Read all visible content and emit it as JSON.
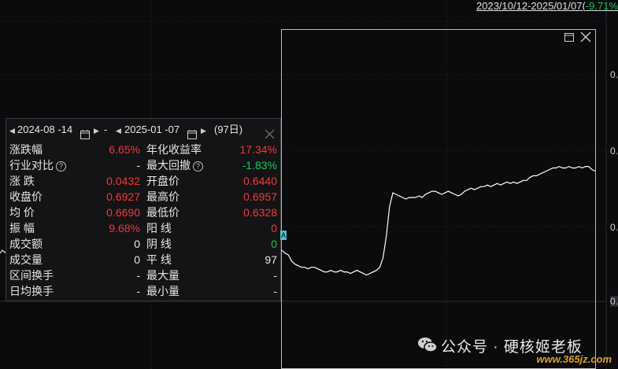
{
  "header": {
    "range_text": "2023/10/12-2025/01/07(",
    "range_change": "-9.71%"
  },
  "y_axis": {
    "tick_prefix": [
      "0.",
      "0.",
      "0.",
      "0."
    ]
  },
  "chart_data": {
    "type": "line",
    "series": [
      {
        "values": [
          0.647,
          0.645,
          0.644,
          0.64,
          0.638,
          0.637,
          0.636,
          0.636,
          0.635,
          0.636,
          0.636,
          0.635,
          0.634,
          0.633,
          0.633,
          0.634,
          0.633,
          0.633,
          0.634,
          0.633,
          0.633,
          0.632,
          0.633,
          0.634,
          0.633,
          0.632,
          0.631,
          0.632,
          0.633,
          0.634,
          0.636,
          0.642,
          0.656,
          0.675,
          0.684,
          0.683,
          0.682,
          0.681,
          0.68,
          0.681,
          0.681,
          0.681,
          0.682,
          0.681,
          0.683,
          0.684,
          0.685,
          0.685,
          0.684,
          0.683,
          0.684,
          0.685,
          0.684,
          0.683,
          0.682,
          0.683,
          0.685,
          0.686,
          0.687,
          0.686,
          0.687,
          0.688,
          0.688,
          0.689,
          0.688,
          0.689,
          0.69,
          0.689,
          0.69,
          0.691,
          0.69,
          0.691,
          0.69,
          0.691,
          0.692,
          0.692,
          0.694,
          0.695,
          0.695,
          0.696,
          0.697,
          0.698,
          0.699,
          0.7,
          0.7,
          0.701,
          0.7,
          0.7,
          0.701,
          0.7,
          0.7,
          0.701,
          0.7,
          0.701,
          0.701,
          0.699,
          0.698
        ]
      }
    ]
  },
  "panel": {
    "start_date": "2024-08 -14",
    "end_date": "2025-01 -07",
    "separator": "-",
    "days": "(97日)",
    "rows": [
      {
        "l_label": "涨跌幅",
        "l_value": "6.65%",
        "r_label": "年化收益率",
        "r_value": "17.34%"
      },
      {
        "l_label": "行业对比",
        "l_value": "-",
        "r_label": "最大回撤",
        "r_value": "-1.83%"
      },
      {
        "l_label": "涨  跌",
        "l_value": "0.0432",
        "r_label": "开盘价",
        "r_value": "0.6440"
      },
      {
        "l_label": "收盘价",
        "l_value": "0.6927",
        "r_label": "最高价",
        "r_value": "0.6957"
      },
      {
        "l_label": "均  价",
        "l_value": "0.6690",
        "r_label": "最低价",
        "r_value": "0.6328"
      },
      {
        "l_label": "振  幅",
        "l_value": "9.68%",
        "r_label": "阳  线",
        "r_value": "0"
      },
      {
        "l_label": "成交额",
        "l_value": "0",
        "r_label": "阴  线",
        "r_value": "0"
      },
      {
        "l_label": "成交量",
        "l_value": "0",
        "r_label": "平  线",
        "r_value": "97"
      },
      {
        "l_label": "区间换手",
        "l_value": "-",
        "r_label": "最大量",
        "r_value": "-"
      },
      {
        "l_label": "日均换手",
        "l_value": "-",
        "r_label": "最小量",
        "r_value": "-"
      }
    ],
    "help_glyph": "?"
  },
  "marker_text": "A",
  "watermark": "公众号 · 硬核姬老板",
  "site": "www.365jz.com",
  "colors": {
    "up": "#f0393c",
    "down": "#1fc45a",
    "line": "#ffffff"
  }
}
